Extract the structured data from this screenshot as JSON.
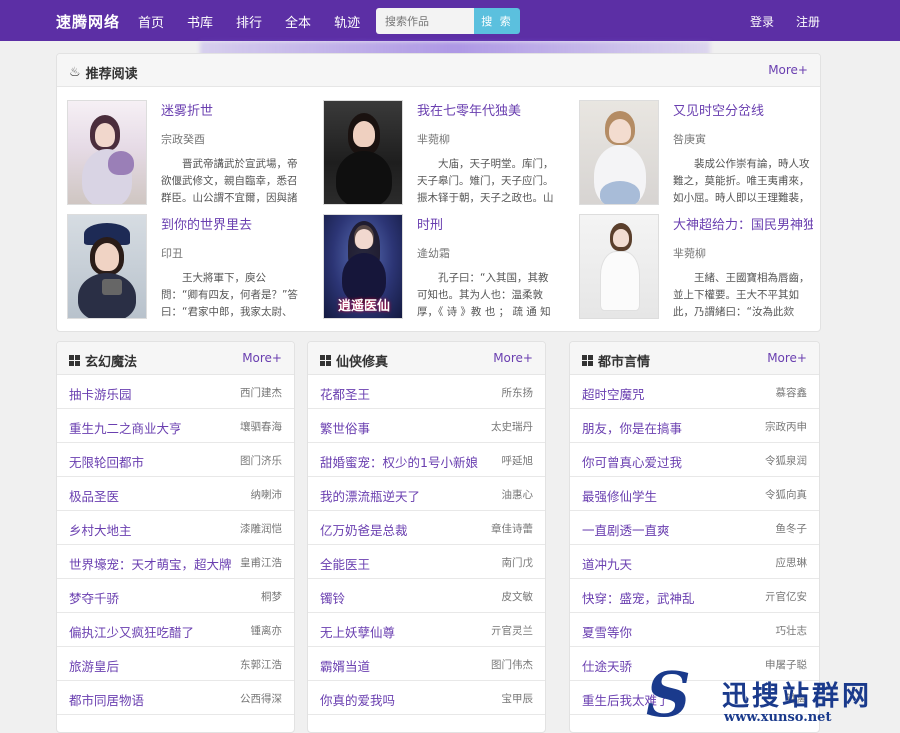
{
  "brand": "速腾网络",
  "nav": [
    "首页",
    "书库",
    "排行",
    "全本",
    "轨迹"
  ],
  "search": {
    "placeholder": "搜索作品",
    "button": "搜 索"
  },
  "auth": {
    "login": "登录",
    "register": "注册"
  },
  "recommend": {
    "title": "推荐阅读",
    "more": "More+",
    "books": [
      {
        "title": "迷雾折世",
        "author": "宗政癸酉",
        "desc": "晋武帝講武於宣武場，帝欲偃武修文，親自臨幸，悉召群臣。山公謂不宜爾，因與諸"
      },
      {
        "title": "我在七零年代独美",
        "author": "芈菀柳",
        "desc": "大庙，天子明堂。库门，天子皋门。雉门，天子应门。振木铎于朝，天子之政也。山"
      },
      {
        "title": "又见时空分岔线",
        "author": "咎庚寅",
        "desc": "裴成公作崇有論，時人攻難之，莫能折。唯王夷甫來，如小屈。時人即以王理難裴，"
      },
      {
        "title": "到你的世界里去",
        "author": "印丑",
        "desc": "王大將軍下，庾公問：“卿有四友，何者是？”答曰：“君家中郎，我家太尉、阿平、胡"
      },
      {
        "title": "时刑",
        "author": "逄幼霜",
        "desc": "孔子曰：“入其国，其教可知也。其为人也：温柔敦厚，《 诗 》教 也 ； 疏 通 知 远 ，"
      },
      {
        "title": "大神超给力：国民男神独",
        "author": "芈菀柳",
        "desc": "王緒、王國寶相為唇齒，並上下權要。王大不平其如此，乃謂緒曰：“汝為此欻欻，"
      }
    ],
    "cover_text_5": "逍遥医仙"
  },
  "categories": [
    {
      "title": "玄幻魔法",
      "more": "More+",
      "rows": [
        {
          "title": "抽卡游乐园",
          "author": "西门建杰"
        },
        {
          "title": "重生九二之商业大亨",
          "author": "壤驷春海"
        },
        {
          "title": "无限轮回都市",
          "author": "图门济乐"
        },
        {
          "title": "极品圣医",
          "author": "纳喇沛"
        },
        {
          "title": "乡村大地主",
          "author": "漆雕润恺"
        },
        {
          "title": "世界壕宠：天才萌宝，超大牌",
          "author": "皇甫江浩"
        },
        {
          "title": "梦夺千骄",
          "author": "桐梦"
        },
        {
          "title": "偏执江少又疯狂吃醋了",
          "author": "锺离亦"
        },
        {
          "title": "旅游皇后",
          "author": "东郭江浩"
        },
        {
          "title": "都市同居物语",
          "author": "公西得深"
        }
      ]
    },
    {
      "title": "仙侠修真",
      "more": "More+",
      "rows": [
        {
          "title": "花都圣王",
          "author": "所东扬"
        },
        {
          "title": "繁世俗事",
          "author": "太史瑞丹"
        },
        {
          "title": "甜婚蜜宠：权少的1号小新娘",
          "author": "呼延旭"
        },
        {
          "title": "我的漂流瓶逆天了",
          "author": "油惠心"
        },
        {
          "title": "亿万奶爸是总裁",
          "author": "章佳诗蕾"
        },
        {
          "title": "全能医王",
          "author": "南门戊"
        },
        {
          "title": "镯铃",
          "author": "皮文敏"
        },
        {
          "title": "无上妖孽仙尊",
          "author": "亓官灵兰"
        },
        {
          "title": "霸婿当道",
          "author": "图门伟杰"
        },
        {
          "title": "你真的爱我吗",
          "author": "宝甲辰"
        }
      ]
    },
    {
      "title": "都市言情",
      "more": "More+",
      "rows": [
        {
          "title": "超时空魔咒",
          "author": "慕容鑫"
        },
        {
          "title": "朋友，你是在搞事",
          "author": "宗政丙申"
        },
        {
          "title": "你可曾真心爱过我",
          "author": "令狐泉润"
        },
        {
          "title": "最强修仙学生",
          "author": "令狐向真"
        },
        {
          "title": "一直剧透一直爽",
          "author": "鱼冬子"
        },
        {
          "title": "道冲九天",
          "author": "应思琳"
        },
        {
          "title": "快穿：盛宠，武神乱",
          "author": "亓官亿安"
        },
        {
          "title": "夏雪等你",
          "author": "巧壮志"
        },
        {
          "title": "仕途天骄",
          "author": "申屠子聪"
        },
        {
          "title": "重生后我太难了",
          "author": "钟离"
        }
      ]
    }
  ],
  "watermark": {
    "letter": "S",
    "name": "迅搜站群网",
    "url": "www.xunso.net"
  }
}
